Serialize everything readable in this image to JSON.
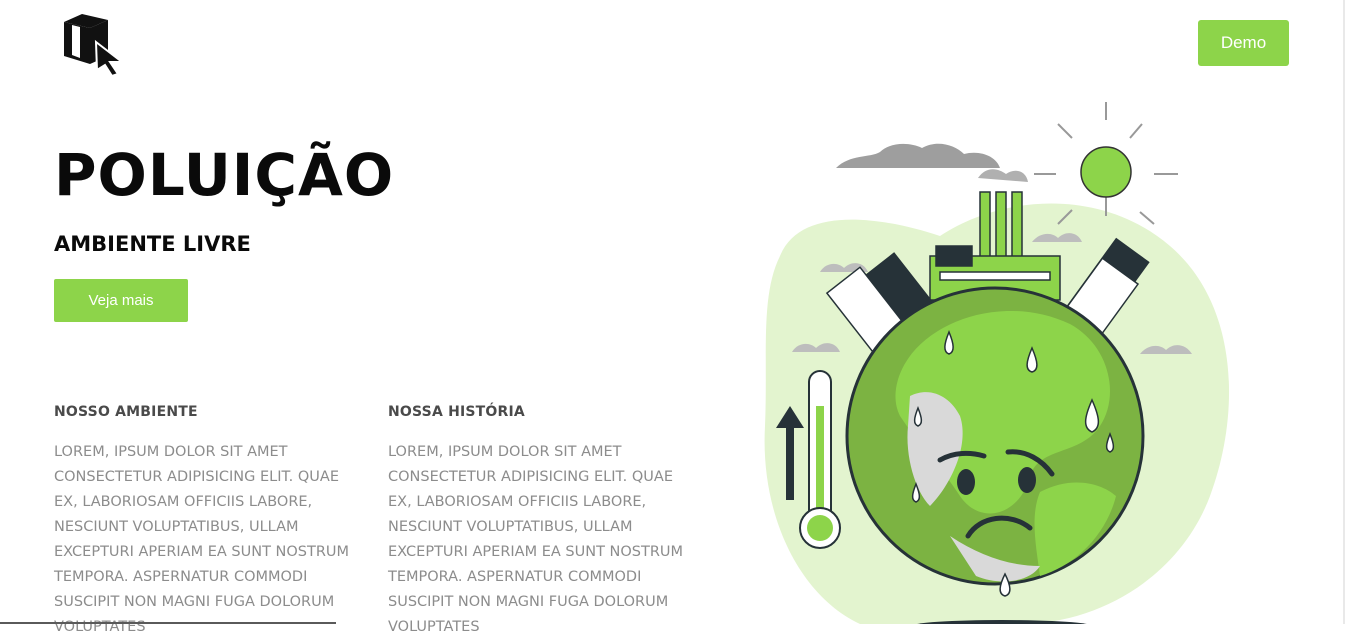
{
  "header": {
    "logo_icon": "cube-cursor-icon",
    "demo_label": "Demo"
  },
  "hero": {
    "title": "POLUIÇÃO",
    "subtitle": "AMBIENTE LIVRE",
    "cta_label": "Veja mais"
  },
  "sections": [
    {
      "heading": "NOSSO AMBIENTE",
      "body": "LOREM, IPSUM DOLOR SIT AMET CONSECTETUR ADIPISICING ELIT. QUAE EX, LABORIOSAM OFFICIIS LABORE, NESCIUNT VOLUPTATIBUS, ULLAM EXCEPTURI APERIAM EA SUNT NOSTRUM TEMPORA. ASPERNATUR COMMODI SUSCIPIT NON MAGNI FUGA DOLORUM VOLUPTATES"
    },
    {
      "heading": "NOSSA HISTÓRIA",
      "body": "LOREM, IPSUM DOLOR SIT AMET CONSECTETUR ADIPISICING ELIT. QUAE EX, LABORIOSAM OFFICIIS LABORE, NESCIUNT VOLUPTATIBUS, ULLAM EXCEPTURI APERIAM EA SUNT NOSTRUM TEMPORA. ASPERNATUR COMMODI SUSCIPIT NON MAGNI FUGA DOLORUM VOLUPTATES"
    }
  ],
  "illustration": {
    "name": "polluted-earth-illustration",
    "colors": {
      "accent": "#8dd44a",
      "blob": "#e3f4cf",
      "dark": "#263238",
      "smoke": "#9e9e9e"
    }
  }
}
